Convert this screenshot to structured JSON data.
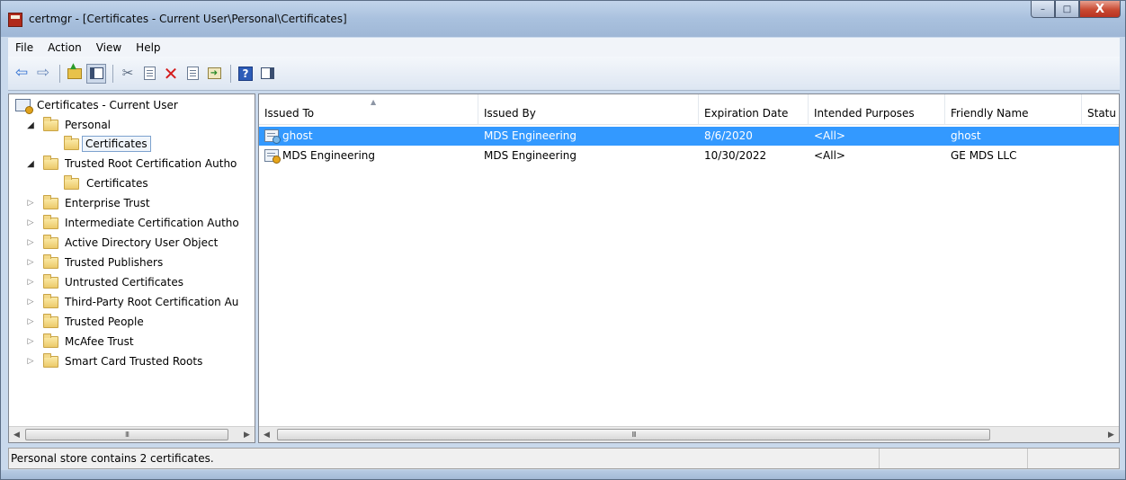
{
  "window": {
    "title": "certmgr - [Certificates - Current User\\Personal\\Certificates]",
    "caption_buttons": {
      "minimize": "–",
      "maximize": "□",
      "close": "X"
    }
  },
  "menu": [
    "File",
    "Action",
    "View",
    "Help"
  ],
  "toolbar": {
    "icons": [
      "back-icon",
      "forward-icon",
      "up-folder-icon",
      "show-hide-console-tree-icon",
      "cut-icon",
      "copy-icon",
      "delete-icon",
      "properties-icon",
      "export-list-icon",
      "help-icon",
      "show-hide-action-pane-icon"
    ]
  },
  "tree": {
    "root": "Certificates - Current User",
    "items": [
      {
        "label": "Personal",
        "expanded": true
      },
      {
        "label": "Certificates",
        "selected": true,
        "child": true
      },
      {
        "label": "Trusted Root Certification Autho",
        "expanded": true
      },
      {
        "label": "Certificates",
        "child": true
      },
      {
        "label": "Enterprise Trust"
      },
      {
        "label": "Intermediate Certification Autho"
      },
      {
        "label": "Active Directory User Object"
      },
      {
        "label": "Trusted Publishers"
      },
      {
        "label": "Untrusted Certificates"
      },
      {
        "label": "Third-Party Root Certification Au"
      },
      {
        "label": "Trusted People"
      },
      {
        "label": "McAfee Trust"
      },
      {
        "label": "Smart Card Trusted Roots"
      }
    ],
    "scroll_glyph": "III"
  },
  "list": {
    "columns": [
      "Issued To",
      "Issued By",
      "Expiration Date",
      "Intended Purposes",
      "Friendly Name",
      "Statu"
    ],
    "rows": [
      {
        "issued_to": "ghost",
        "issued_by": "MDS Engineering",
        "expiration": "8/6/2020",
        "purposes": "<All>",
        "friendly": "ghost",
        "selected": true
      },
      {
        "issued_to": "MDS Engineering",
        "issued_by": "MDS Engineering",
        "expiration": "10/30/2022",
        "purposes": "<All>",
        "friendly": "GE MDS LLC",
        "selected": false
      }
    ],
    "scroll_glyph": "III"
  },
  "status": {
    "text": "Personal store contains 2 certificates."
  },
  "colors": {
    "selection": "#3399ff",
    "frame": "#c9d9ec",
    "delete": "#d41b1b"
  }
}
